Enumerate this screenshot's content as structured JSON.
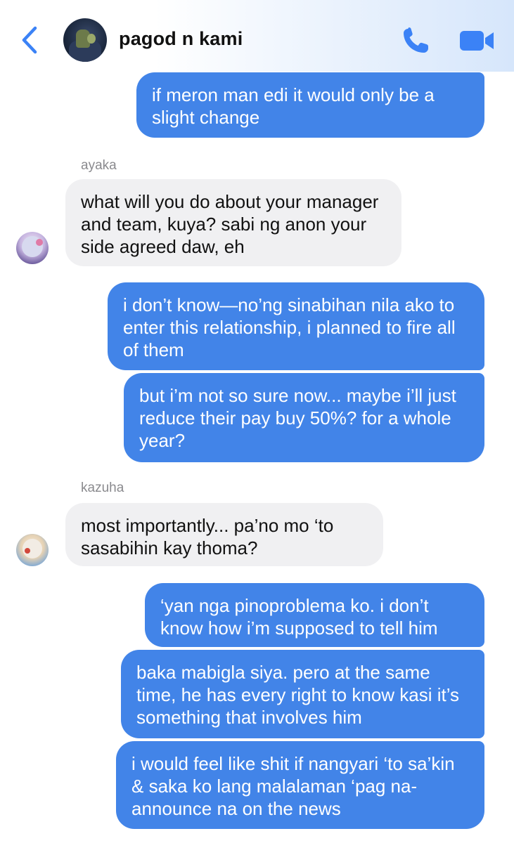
{
  "header": {
    "title": "pagod n kami",
    "back_icon": "chevron-left-icon",
    "call_icon": "phone-icon",
    "video_icon": "video-camera-icon",
    "accent_color": "#3b82f6"
  },
  "colors": {
    "outgoing_bubble": "#4284e8",
    "incoming_bubble": "#f0f0f2",
    "sender_name": "#8a8a8e"
  },
  "messages": [
    {
      "dir": "out",
      "text": "if meron man edi it would only be a slight change"
    },
    {
      "dir": "in",
      "sender": "ayaka",
      "text": "what will you do about your manager and team, kuya? sabi ng anon your side agreed daw, eh"
    },
    {
      "dir": "out",
      "text": "i don’t know—no’ng sinabihan nila ako to enter this relationship, i planned to fire all of them"
    },
    {
      "dir": "out",
      "text": "but i’m not so sure now... maybe i’ll just reduce their pay buy 50%? for a whole year?"
    },
    {
      "dir": "in",
      "sender": "kazuha",
      "text": "most importantly... pa’no mo ‘to sasabihin kay thoma?"
    },
    {
      "dir": "out",
      "text": "‘yan nga pinoproblema ko. i don’t know how i’m supposed to tell him"
    },
    {
      "dir": "out",
      "text": "baka mabigla siya. pero at the same time, he has every right to know kasi it’s something that involves him"
    },
    {
      "dir": "out",
      "text": "i would feel like shit if nangyari ‘to sa’kin & saka ko lang malalaman ‘pag na-announce na on the news"
    }
  ]
}
